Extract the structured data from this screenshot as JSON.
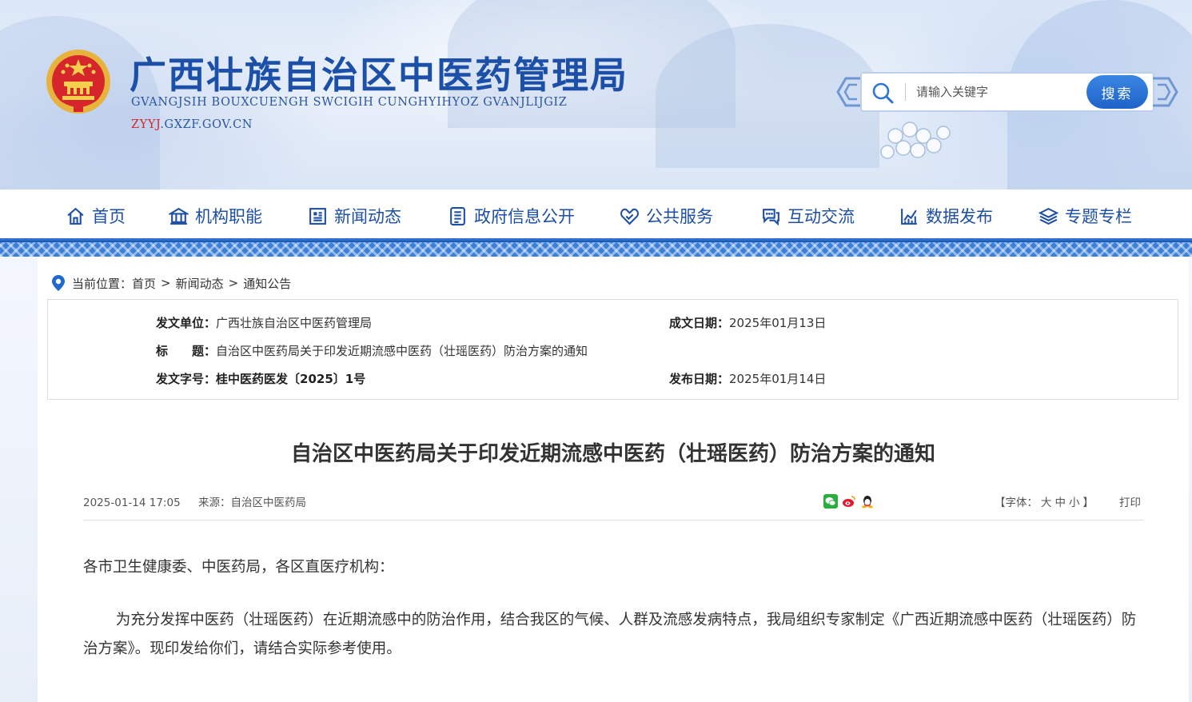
{
  "header": {
    "title": "广西壮族自治区中医药管理局",
    "subtitle": "GVANGJSIH BOUXCUENGH SWCIGIH CUNGHYIHYOZ GVANJLIJGIZ",
    "domain_red": "ZYYJ",
    "domain_rest": ".GXZF.GOV.CN",
    "search": {
      "placeholder": "请输入关键字",
      "button_label": "搜索"
    }
  },
  "nav": {
    "items": [
      {
        "label": "首页",
        "icon": "home-icon"
      },
      {
        "label": "机构职能",
        "icon": "building-icon"
      },
      {
        "label": "新闻动态",
        "icon": "newspaper-icon"
      },
      {
        "label": "政府信息公开",
        "icon": "document-list-icon"
      },
      {
        "label": "公共服务",
        "icon": "heart-hands-icon"
      },
      {
        "label": "互动交流",
        "icon": "chat-icon"
      },
      {
        "label": "数据发布",
        "icon": "chart-icon"
      },
      {
        "label": "专题专栏",
        "icon": "layers-icon"
      }
    ]
  },
  "breadcrumb": {
    "prefix": "当前位置：",
    "items": [
      "首页",
      "新闻动态",
      "通知公告"
    ],
    "separator": ">"
  },
  "meta": {
    "issuer_label": "发文单位：",
    "issuer": "广西壮族自治区中医药管理局",
    "date_made_label": "成文日期：",
    "date_made": "2025年01月13日",
    "title_label": "标　　题：",
    "title": "自治区中医药局关于印发近期流感中医药（壮瑶医药）防治方案的通知",
    "doc_no_label": "发文字号：",
    "doc_no": "桂中医药医发〔2025〕1号",
    "pub_date_label": "发布日期：",
    "pub_date": "2025年01月14日"
  },
  "article": {
    "title": "自治区中医药局关于印发近期流感中医药（壮瑶医药）防治方案的通知",
    "datetime": "2025-01-14 17:05",
    "source_label": "来源：",
    "source": "自治区中医药局",
    "font_label_open": "【字体：",
    "font_large": "大",
    "font_medium": "中",
    "font_small": "小",
    "font_label_close": "】",
    "print_label": "打印",
    "greeting": "各市卫生健康委、中医药局，各区直医疗机构：",
    "body": "为充分发挥中医药（壮瑶医药）在近期流感中的防治作用，结合我区的气候、人群及流感发病特点，我局组织专家制定《广西近期流感中医药（壮瑶医药）防治方案》。现印发给你们，请结合实际参考使用。"
  },
  "colors": {
    "brand_blue": "#1c4fa8",
    "accent_red": "#d6262b",
    "nav_band": "#3b7fd7"
  }
}
